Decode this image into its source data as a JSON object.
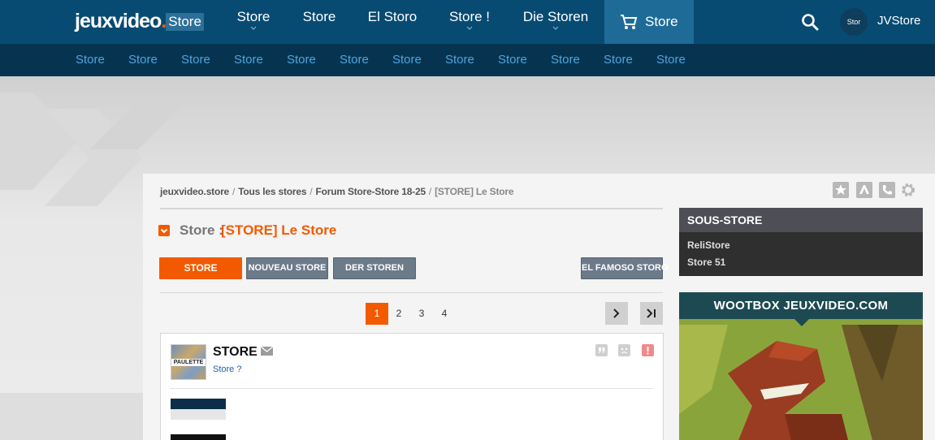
{
  "header": {
    "logo_main": "jeuxvideo",
    "logo_dot": ".",
    "logo_suffix": "Store",
    "nav": [
      {
        "label": "Store"
      },
      {
        "label": "Store"
      },
      {
        "label": "El Storo"
      },
      {
        "label": "Store !"
      },
      {
        "label": "Die Storen"
      }
    ],
    "cart_label": "Store",
    "account_avatar_text": "Stor",
    "account_name": "JVStore",
    "accent": "#f35a00",
    "bar_color": "#084b72"
  },
  "subnav": [
    "Store",
    "Store",
    "Store",
    "Store",
    "Store",
    "Store",
    "Store",
    "Store",
    "Store",
    "Store",
    "Store",
    "Store"
  ],
  "breadcrumb": {
    "items": [
      "jeuxvideo.store",
      "Tous les stores",
      "Forum Store-Store 18-25"
    ],
    "current": "[STORE] Le Store"
  },
  "topic": {
    "prefix": "Store :",
    "title": "[STORE] Le Store"
  },
  "actions": {
    "primary": "Store",
    "new": "Nouveau store",
    "der": "Der storen",
    "famoso": "El famoso storo"
  },
  "pagination": {
    "pages": [
      "1",
      "2",
      "3",
      "4"
    ],
    "active": "1"
  },
  "post": {
    "author": "STORE",
    "subtitle": "Store ?",
    "avatar_tag": "PAULETTE"
  },
  "sidebar": {
    "title": "SOUS-STORE",
    "links": [
      "ReliStore",
      "Store 51"
    ]
  },
  "ad": {
    "title": "WOOTBOX JEUXVIDEO.COM"
  }
}
